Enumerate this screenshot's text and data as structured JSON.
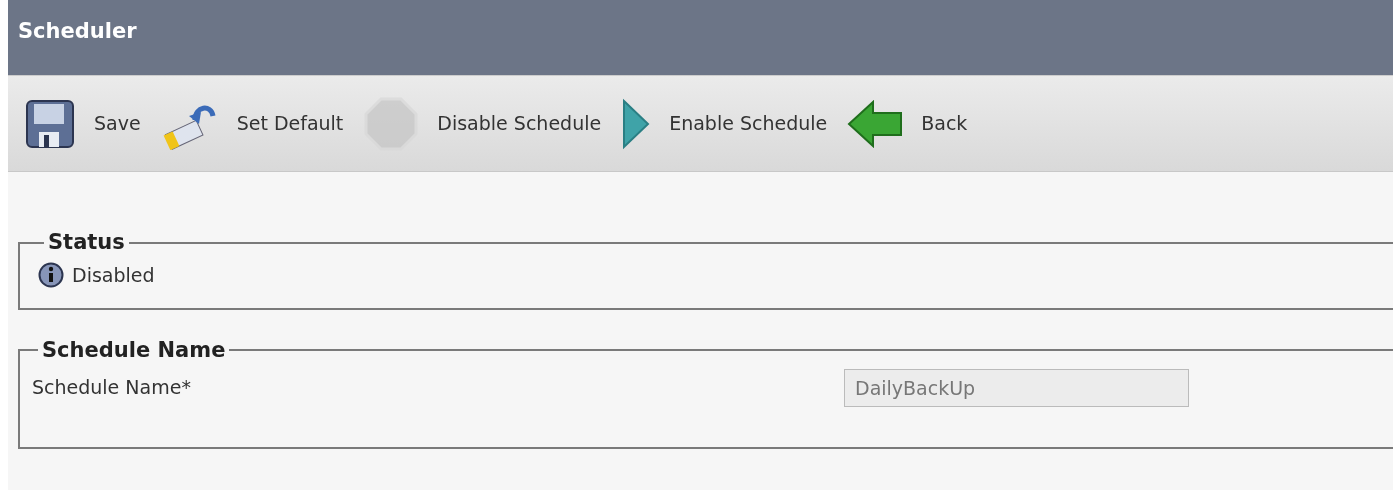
{
  "window": {
    "title": "Scheduler"
  },
  "toolbar": [
    {
      "kind": "save",
      "label": "Save",
      "disabled": false
    },
    {
      "kind": "set-default",
      "label": "Set Default",
      "disabled": false
    },
    {
      "kind": "disable",
      "label": "Disable Schedule",
      "disabled": true
    },
    {
      "kind": "enable",
      "label": "Enable Schedule",
      "disabled": false
    },
    {
      "kind": "back",
      "label": "Back",
      "disabled": false
    }
  ],
  "status": {
    "legend": "Status",
    "text": "Disabled"
  },
  "schedule_name": {
    "legend": "Schedule Name",
    "label": "Schedule Name*",
    "value": "DailyBackUp",
    "readonly": true
  }
}
